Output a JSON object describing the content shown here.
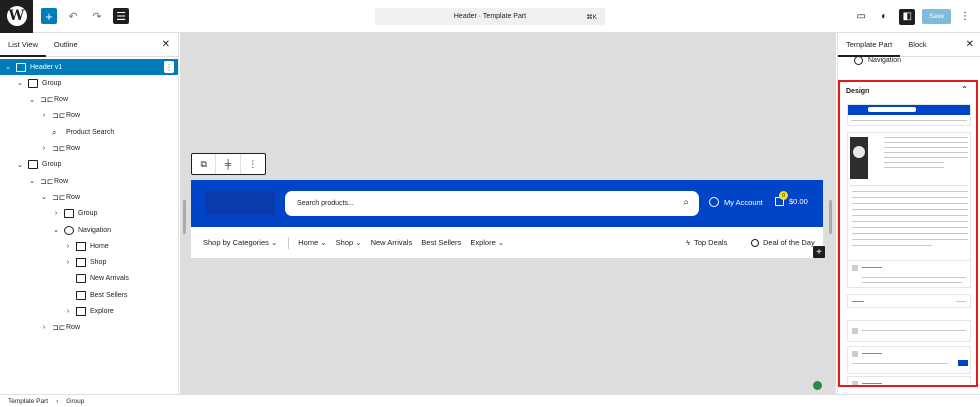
{
  "topbar": {
    "command_bar_title": "Header · Template Part",
    "command_shortcut": "⌘K",
    "save_label": "Save"
  },
  "left_panel": {
    "tabs": [
      "List View",
      "Outline"
    ],
    "tree": [
      {
        "label": "Header v1",
        "type": "template-part",
        "depth": 0,
        "expanded": true,
        "selected": true
      },
      {
        "label": "Group",
        "type": "group",
        "depth": 1,
        "expanded": true
      },
      {
        "label": "Row",
        "type": "row",
        "depth": 2,
        "expanded": true
      },
      {
        "label": "Row",
        "type": "row",
        "depth": 3,
        "expanded": false
      },
      {
        "label": "Product Search",
        "type": "search",
        "depth": 3,
        "expanded": null
      },
      {
        "label": "Row",
        "type": "row",
        "depth": 3,
        "expanded": false
      },
      {
        "label": "Group",
        "type": "group",
        "depth": 1,
        "expanded": true
      },
      {
        "label": "Row",
        "type": "row",
        "depth": 2,
        "expanded": true
      },
      {
        "label": "Row",
        "type": "row",
        "depth": 3,
        "expanded": true
      },
      {
        "label": "Group",
        "type": "group",
        "depth": 4,
        "expanded": false
      },
      {
        "label": "Navigation",
        "type": "navigation",
        "depth": 4,
        "expanded": true
      },
      {
        "label": "Home",
        "type": "page",
        "depth": 5,
        "expanded": false
      },
      {
        "label": "Shop",
        "type": "page",
        "depth": 5,
        "expanded": false
      },
      {
        "label": "New Arrivals",
        "type": "link",
        "depth": 5,
        "expanded": null
      },
      {
        "label": "Best Sellers",
        "type": "link",
        "depth": 5,
        "expanded": null
      },
      {
        "label": "Explore",
        "type": "page",
        "depth": 5,
        "expanded": false
      },
      {
        "label": "Row",
        "type": "row",
        "depth": 3,
        "expanded": false
      }
    ]
  },
  "canvas": {
    "search_placeholder": "Search products...",
    "account_label": "My Account",
    "cart_count": "0",
    "cart_total": "$0.00",
    "nav": {
      "categories": "Shop by Categories",
      "items": [
        "Home",
        "Shop",
        "New Arrivals",
        "Best Sellers",
        "Explore"
      ],
      "top_deals": "Top Deals",
      "deal_of_day": "Deal of the Day"
    },
    "colors": {
      "header_blue": "#0044c7",
      "badge_yellow": "#f5e21a"
    }
  },
  "right_panel": {
    "tabs": [
      "Template Part",
      "Block"
    ],
    "navigation_label": "Navigation",
    "design_title": "Design"
  },
  "footer": {
    "breadcrumb": [
      "Template Part",
      "Group"
    ]
  }
}
